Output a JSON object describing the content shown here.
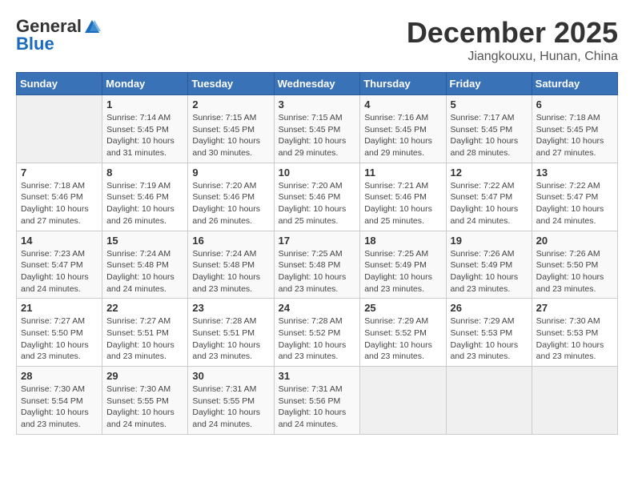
{
  "header": {
    "logo_general": "General",
    "logo_blue": "Blue",
    "month": "December 2025",
    "location": "Jiangkouxu, Hunan, China"
  },
  "weekdays": [
    "Sunday",
    "Monday",
    "Tuesday",
    "Wednesday",
    "Thursday",
    "Friday",
    "Saturday"
  ],
  "weeks": [
    [
      {
        "day": "",
        "empty": true
      },
      {
        "day": "1",
        "sunrise": "7:14 AM",
        "sunset": "5:45 PM",
        "daylight": "10 hours and 31 minutes."
      },
      {
        "day": "2",
        "sunrise": "7:15 AM",
        "sunset": "5:45 PM",
        "daylight": "10 hours and 30 minutes."
      },
      {
        "day": "3",
        "sunrise": "7:15 AM",
        "sunset": "5:45 PM",
        "daylight": "10 hours and 29 minutes."
      },
      {
        "day": "4",
        "sunrise": "7:16 AM",
        "sunset": "5:45 PM",
        "daylight": "10 hours and 29 minutes."
      },
      {
        "day": "5",
        "sunrise": "7:17 AM",
        "sunset": "5:45 PM",
        "daylight": "10 hours and 28 minutes."
      },
      {
        "day": "6",
        "sunrise": "7:18 AM",
        "sunset": "5:45 PM",
        "daylight": "10 hours and 27 minutes."
      }
    ],
    [
      {
        "day": "7",
        "sunrise": "7:18 AM",
        "sunset": "5:46 PM",
        "daylight": "10 hours and 27 minutes."
      },
      {
        "day": "8",
        "sunrise": "7:19 AM",
        "sunset": "5:46 PM",
        "daylight": "10 hours and 26 minutes."
      },
      {
        "day": "9",
        "sunrise": "7:20 AM",
        "sunset": "5:46 PM",
        "daylight": "10 hours and 26 minutes."
      },
      {
        "day": "10",
        "sunrise": "7:20 AM",
        "sunset": "5:46 PM",
        "daylight": "10 hours and 25 minutes."
      },
      {
        "day": "11",
        "sunrise": "7:21 AM",
        "sunset": "5:46 PM",
        "daylight": "10 hours and 25 minutes."
      },
      {
        "day": "12",
        "sunrise": "7:22 AM",
        "sunset": "5:47 PM",
        "daylight": "10 hours and 24 minutes."
      },
      {
        "day": "13",
        "sunrise": "7:22 AM",
        "sunset": "5:47 PM",
        "daylight": "10 hours and 24 minutes."
      }
    ],
    [
      {
        "day": "14",
        "sunrise": "7:23 AM",
        "sunset": "5:47 PM",
        "daylight": "10 hours and 24 minutes."
      },
      {
        "day": "15",
        "sunrise": "7:24 AM",
        "sunset": "5:48 PM",
        "daylight": "10 hours and 24 minutes."
      },
      {
        "day": "16",
        "sunrise": "7:24 AM",
        "sunset": "5:48 PM",
        "daylight": "10 hours and 23 minutes."
      },
      {
        "day": "17",
        "sunrise": "7:25 AM",
        "sunset": "5:48 PM",
        "daylight": "10 hours and 23 minutes."
      },
      {
        "day": "18",
        "sunrise": "7:25 AM",
        "sunset": "5:49 PM",
        "daylight": "10 hours and 23 minutes."
      },
      {
        "day": "19",
        "sunrise": "7:26 AM",
        "sunset": "5:49 PM",
        "daylight": "10 hours and 23 minutes."
      },
      {
        "day": "20",
        "sunrise": "7:26 AM",
        "sunset": "5:50 PM",
        "daylight": "10 hours and 23 minutes."
      }
    ],
    [
      {
        "day": "21",
        "sunrise": "7:27 AM",
        "sunset": "5:50 PM",
        "daylight": "10 hours and 23 minutes."
      },
      {
        "day": "22",
        "sunrise": "7:27 AM",
        "sunset": "5:51 PM",
        "daylight": "10 hours and 23 minutes."
      },
      {
        "day": "23",
        "sunrise": "7:28 AM",
        "sunset": "5:51 PM",
        "daylight": "10 hours and 23 minutes."
      },
      {
        "day": "24",
        "sunrise": "7:28 AM",
        "sunset": "5:52 PM",
        "daylight": "10 hours and 23 minutes."
      },
      {
        "day": "25",
        "sunrise": "7:29 AM",
        "sunset": "5:52 PM",
        "daylight": "10 hours and 23 minutes."
      },
      {
        "day": "26",
        "sunrise": "7:29 AM",
        "sunset": "5:53 PM",
        "daylight": "10 hours and 23 minutes."
      },
      {
        "day": "27",
        "sunrise": "7:30 AM",
        "sunset": "5:53 PM",
        "daylight": "10 hours and 23 minutes."
      }
    ],
    [
      {
        "day": "28",
        "sunrise": "7:30 AM",
        "sunset": "5:54 PM",
        "daylight": "10 hours and 23 minutes."
      },
      {
        "day": "29",
        "sunrise": "7:30 AM",
        "sunset": "5:55 PM",
        "daylight": "10 hours and 24 minutes."
      },
      {
        "day": "30",
        "sunrise": "7:31 AM",
        "sunset": "5:55 PM",
        "daylight": "10 hours and 24 minutes."
      },
      {
        "day": "31",
        "sunrise": "7:31 AM",
        "sunset": "5:56 PM",
        "daylight": "10 hours and 24 minutes."
      },
      {
        "day": "",
        "empty": true
      },
      {
        "day": "",
        "empty": true
      },
      {
        "day": "",
        "empty": true
      }
    ]
  ],
  "labels": {
    "sunrise_prefix": "Sunrise: ",
    "sunset_prefix": "Sunset: ",
    "daylight_prefix": "Daylight: "
  }
}
